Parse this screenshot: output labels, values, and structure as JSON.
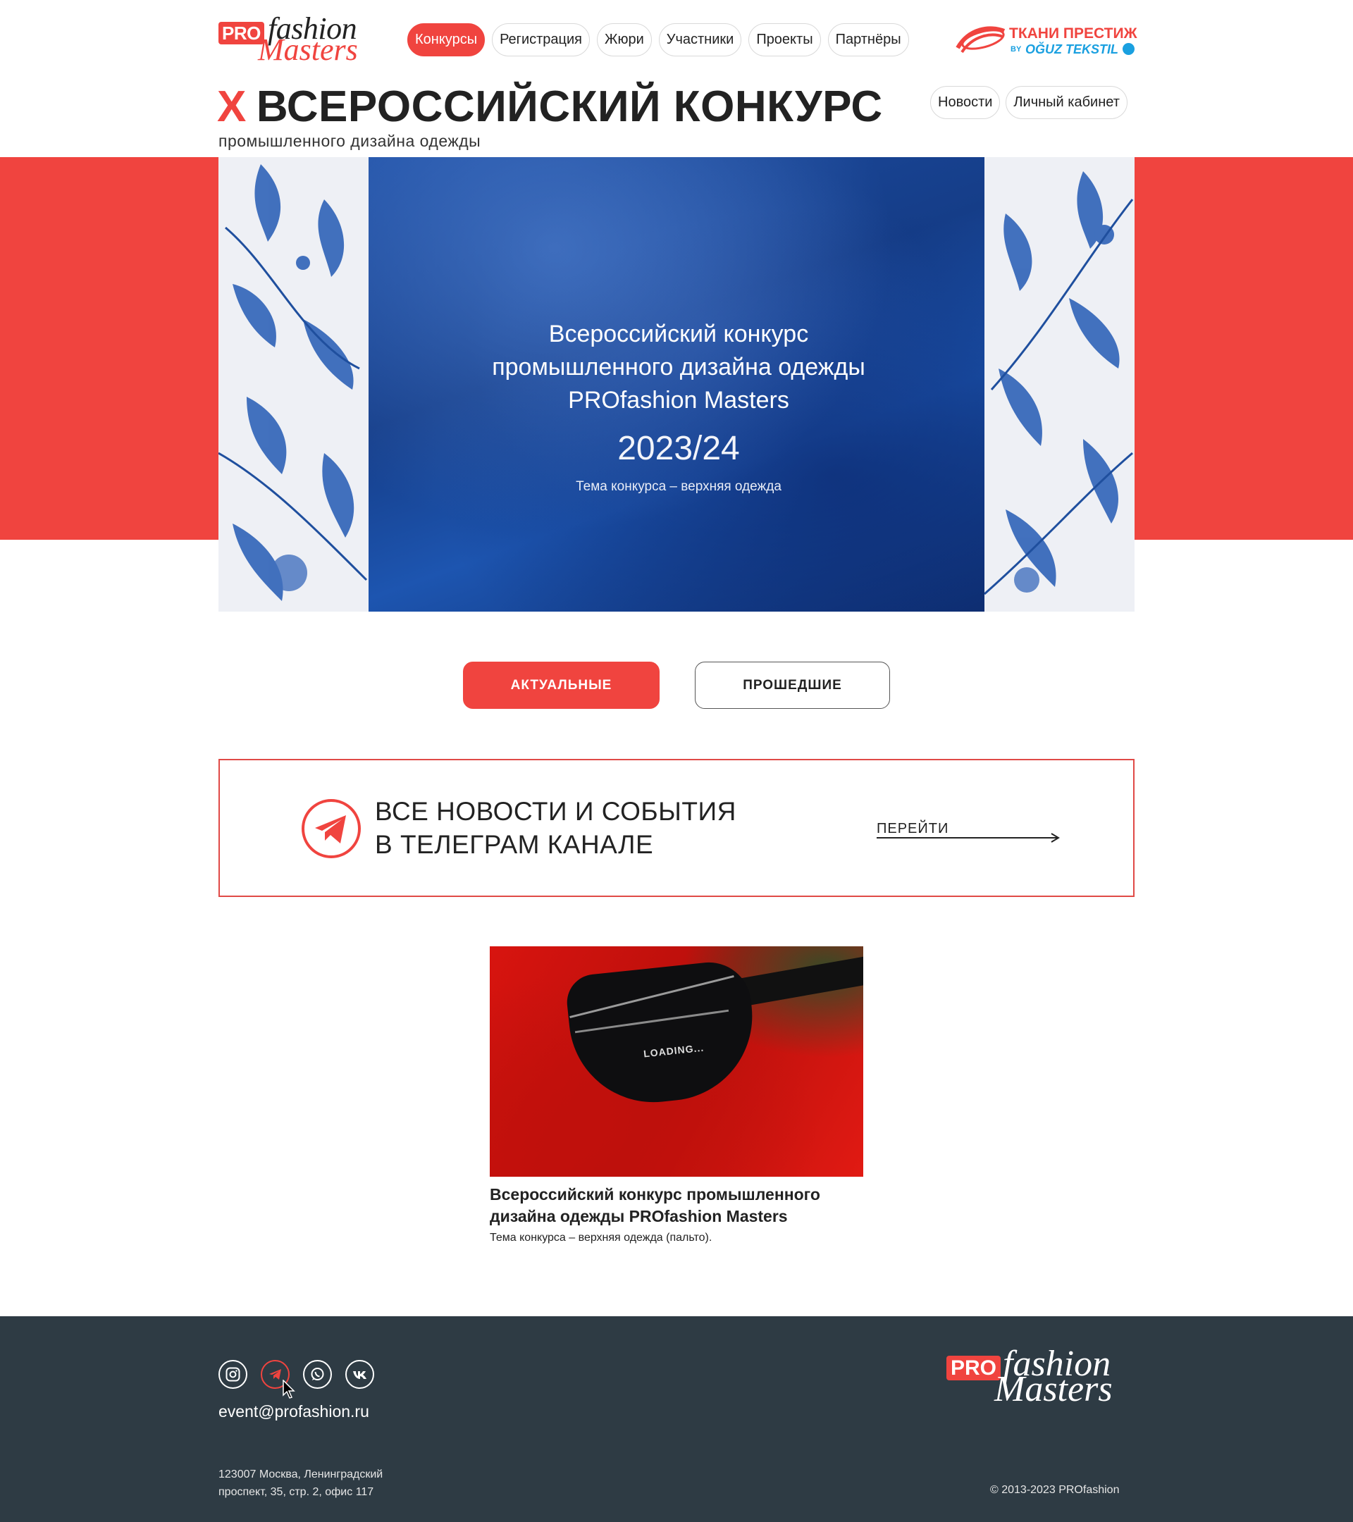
{
  "logo": {
    "pro": "PRO",
    "fashion": "fashion",
    "masters": "Masters"
  },
  "nav": {
    "items": [
      "Конкурсы",
      "Регистрация",
      "Жюри",
      "Участники",
      "Проекты",
      "Партнёры"
    ],
    "active": "Конкурсы"
  },
  "partner": {
    "line1": "ТКАНИ ПРЕСТИЖ",
    "by": "BY",
    "line2": "OĞUZ TEKSTIL"
  },
  "header": {
    "title_numeral": "X",
    "title": "ВСЕРОССИЙСКИЙ КОНКУРС",
    "subtitle": "промышленного дизайна одежды",
    "links": [
      "Новости",
      "Личный кабинет"
    ]
  },
  "hero": {
    "line1": "Всероссийский конкурс",
    "line2": "промышленного дизайна одежды",
    "line3": "PROfashion Masters",
    "year": "2023/24",
    "theme": "Тема конкурса – верхняя одежда"
  },
  "tabs": {
    "current": "АКТУАЛЬНЫЕ",
    "past": "ПРОШЕДШИЕ"
  },
  "telegram_block": {
    "line1": "ВСЕ НОВОСТИ И СОБЫТИЯ",
    "line2": "В ТЕЛЕГРАМ КАНАЛЕ",
    "link": "ПЕРЕЙТИ"
  },
  "news_card": {
    "image_label": "LOADING...",
    "title_line1": "Всероссийский конкурс промышленного",
    "title_line2": "дизайна одежды PROfashion Masters",
    "text": "Тема конкурса – верхняя одежда (пальто)."
  },
  "footer": {
    "socials": [
      "instagram-icon",
      "telegram-icon",
      "whatsapp-icon",
      "vk-icon"
    ],
    "email": "event@profashion.ru",
    "address_line1": "123007 Москва, Ленинградский",
    "address_line2": "проспект, 35, стр. 2, офис 117",
    "copyright": "© 2013-2023 PROfashion"
  },
  "colors": {
    "accent": "#f0443f",
    "footer_bg": "#2e3b44",
    "hero_blue": "#1c4fa0",
    "partner_blue": "#1aa0e0"
  }
}
